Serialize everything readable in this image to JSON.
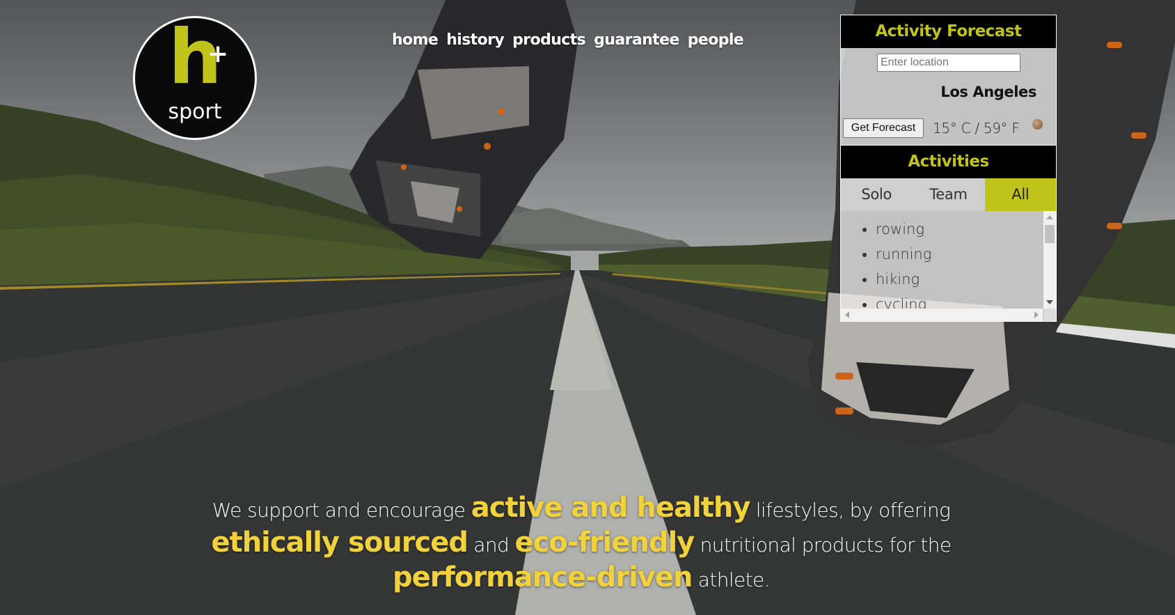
{
  "logo": {
    "mark": "h",
    "plus": "+",
    "word": "sport"
  },
  "nav": {
    "items": [
      {
        "label": "home"
      },
      {
        "label": "history"
      },
      {
        "label": "products"
      },
      {
        "label": "guarantee"
      },
      {
        "label": "people"
      }
    ]
  },
  "forecast": {
    "title": "Activity Forecast",
    "location_placeholder": "Enter location",
    "location_value": "",
    "city": "Los Angeles",
    "button_label": "Get Forecast",
    "temperature": "15° C / 59° F",
    "weather_icon": "weather-icon"
  },
  "activities": {
    "title": "Activities",
    "tabs": [
      {
        "label": "Solo",
        "active": false
      },
      {
        "label": "Team",
        "active": false
      },
      {
        "label": "All",
        "active": true
      }
    ],
    "items": [
      "rowing",
      "running",
      "hiking",
      "cycling"
    ]
  },
  "tagline": {
    "line1_a": "We support and encourage ",
    "line1_hl": "active and healthy",
    "line1_b": " lifestyles, by offering",
    "line2_hl1": "ethically sourced",
    "line2_a": " and ",
    "line2_hl2": "eco-friendly",
    "line2_b": " nutritional products for the",
    "line3_hl": "performance-driven",
    "line3_a": " athlete."
  },
  "colors": {
    "accent": "#c0c41a",
    "highlight": "#f2d23c",
    "panel_dark": "#000000"
  }
}
